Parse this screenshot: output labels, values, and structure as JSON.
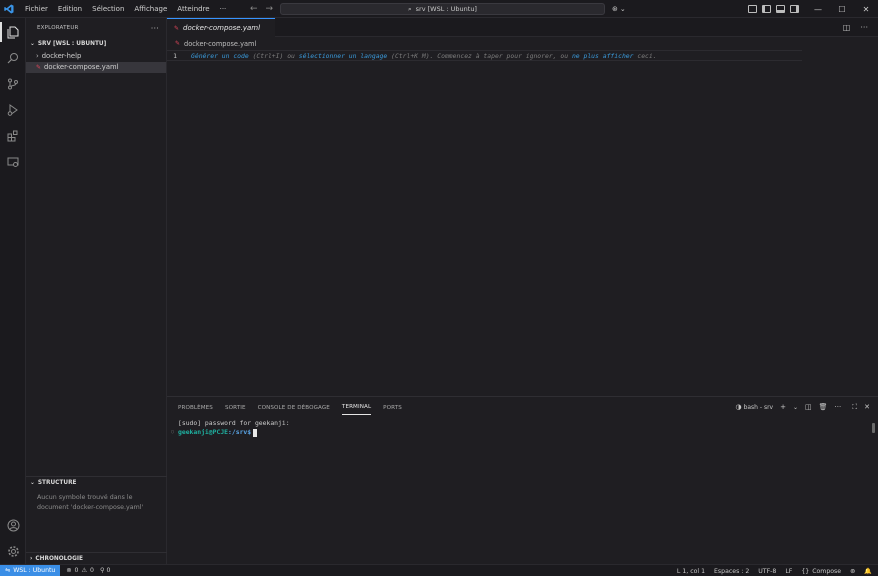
{
  "titlebar": {
    "menu": [
      "Fichier",
      "Edition",
      "Sélection",
      "Affichage",
      "Atteindre"
    ],
    "more": "···",
    "command_center": "srv [WSL : Ubuntu]"
  },
  "sidebar": {
    "title": "EXPLORATEUR",
    "more": "···",
    "root": "SRV [WSL : UBUNTU]",
    "items": [
      {
        "label": "docker-help",
        "type": "folder"
      },
      {
        "label": "docker-compose.yaml",
        "type": "file"
      }
    ],
    "structure": {
      "title": "STRUCTURE",
      "message": "Aucun symbole trouvé dans le document 'docker-compose.yaml'"
    },
    "timeline": {
      "title": "CHRONOLOGIE"
    }
  },
  "editor": {
    "tab_label": "docker-compose.yaml",
    "breadcrumb": "docker-compose.yaml",
    "line_number": "1",
    "hint": {
      "link1": "Générer un code",
      "part1": " (Ctrl+I) ou ",
      "link2": "sélectionner un langage",
      "part2": " (Ctrl+K M). Commencez à taper pour ignorer, ou ",
      "link3": "ne plus afficher",
      "part3": " ceci."
    }
  },
  "panel": {
    "tabs": [
      "PROBLÈMES",
      "SORTIE",
      "CONSOLE DE DÉBOGAGE",
      "TERMINAL",
      "PORTS"
    ],
    "active_tab": "TERMINAL",
    "terminal_name": "bash - srv",
    "lines": {
      "line1": "[sudo] password for geekanji:",
      "prompt_user": "geekanji@PCJE",
      "prompt_path": ":/srv$"
    }
  },
  "statusbar": {
    "remote": "WSL : Ubuntu",
    "errors": "0",
    "warnings": "0",
    "ports": "0",
    "position": "L 1, col 1",
    "spaces": "Espaces : 2",
    "encoding": "UTF-8",
    "eol": "LF",
    "language": "Compose"
  },
  "colors": {
    "accent": "#3a8ee6",
    "yaml_icon": "#e0465a",
    "link": "#3a9bdc",
    "prompt": "#1fb0a0"
  }
}
